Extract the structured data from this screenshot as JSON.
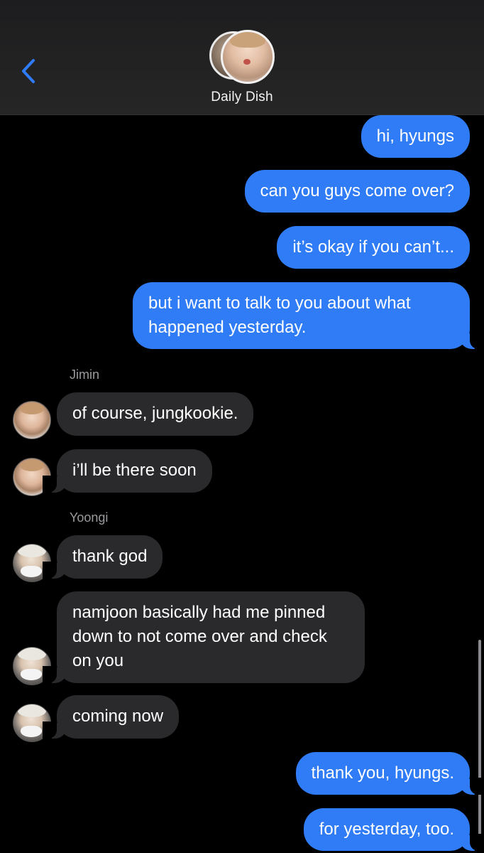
{
  "header": {
    "title": "Daily Dish",
    "back_icon": "chevron-left-icon",
    "accent_color": "#2f7cf6"
  },
  "messages": [
    {
      "from": "me",
      "text": "hi, hyungs"
    },
    {
      "from": "me",
      "text": "can you guys come over?"
    },
    {
      "from": "me",
      "text": "it’s okay if you can’t..."
    },
    {
      "from": "me",
      "text": "but i want to talk to you about what happened yesterday."
    },
    {
      "sender_label": "Jimin"
    },
    {
      "from": "Jimin",
      "text": "of course, jungkookie."
    },
    {
      "from": "Jimin",
      "text": "i’ll be there soon"
    },
    {
      "sender_label": "Yoongi"
    },
    {
      "from": "Yoongi",
      "text": "thank god"
    },
    {
      "from": "Yoongi",
      "text": "namjoon basically had me pinned down to not come over and check on you"
    },
    {
      "from": "Yoongi",
      "text": "coming now"
    },
    {
      "from": "me",
      "text": "thank you, hyungs."
    },
    {
      "from": "me",
      "text": "for yesterday, too."
    }
  ]
}
